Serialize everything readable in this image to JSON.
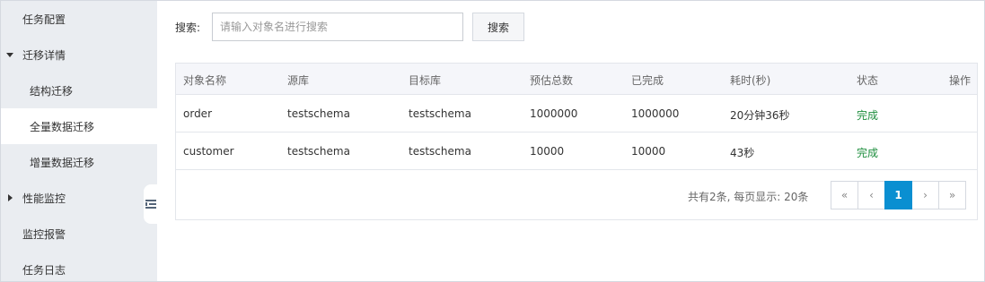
{
  "sidebar": {
    "items": [
      {
        "label": "任务配置"
      },
      {
        "label": "迁移详情"
      },
      {
        "label": "结构迁移"
      },
      {
        "label": "全量数据迁移"
      },
      {
        "label": "增量数据迁移"
      },
      {
        "label": "性能监控"
      },
      {
        "label": "监控报警"
      },
      {
        "label": "任务日志"
      }
    ]
  },
  "search": {
    "label": "搜索:",
    "placeholder": "请输入对象名进行搜索",
    "button": "搜索"
  },
  "table": {
    "headers": [
      "对象名称",
      "源库",
      "目标库",
      "预估总数",
      "已完成",
      "耗时(秒)",
      "状态",
      "操作"
    ],
    "rows": [
      [
        "order",
        "testschema",
        "testschema",
        "1000000",
        "1000000",
        "20分钟36秒",
        "完成"
      ],
      [
        "customer",
        "testschema",
        "testschema",
        "10000",
        "10000",
        "43秒",
        "完成"
      ]
    ]
  },
  "pagination": {
    "info": "共有2条, 每页显示: 20条",
    "first": "«",
    "prev": "‹",
    "current": "1",
    "next": "›",
    "last": "»"
  },
  "colors": {
    "sidebar_bg": "#eaedf1",
    "accent": "#0a8fd1",
    "status_done": "#1e8e3e"
  },
  "icons": {
    "collapse": "menu-collapse-icon",
    "expanded": "caret-down-icon",
    "collapsed": "caret-right-icon"
  }
}
